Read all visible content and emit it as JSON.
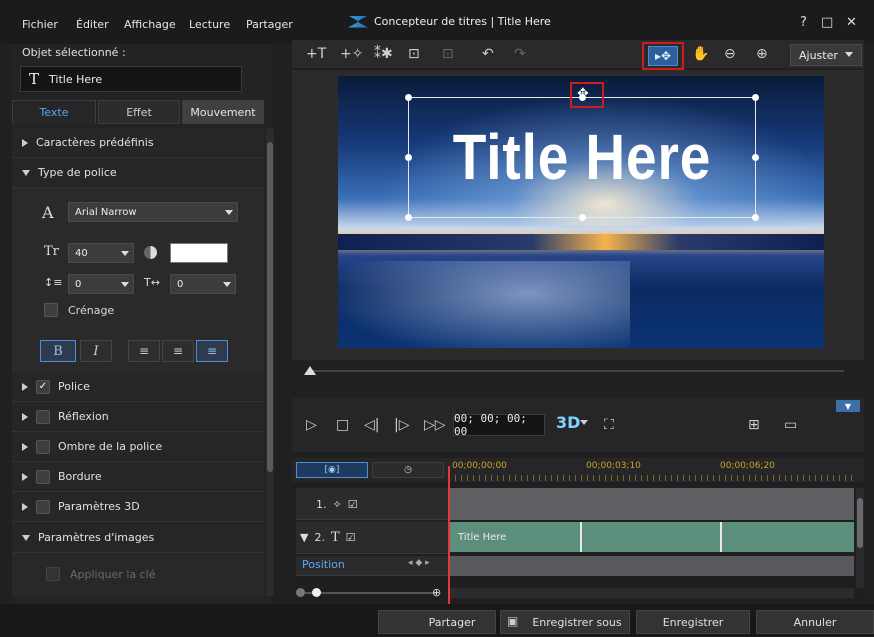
{
  "menu": {
    "items": [
      "Fichier",
      "Éditer",
      "Affichage",
      "Lecture",
      "Partager"
    ]
  },
  "window": {
    "title": "Concepteur de titres  |  Title Here",
    "help": "?",
    "maximize": "□",
    "close": "✕"
  },
  "selected_object": {
    "label": "Objet sélectionné :",
    "value": "Title Here",
    "icon": "T"
  },
  "tabs": [
    "Texte",
    "Effet",
    "Mouvement"
  ],
  "sections": {
    "caracteres": "Caractères prédéfinis",
    "type_police": "Type de police",
    "police": "Police",
    "reflexion": "Réflexion",
    "ombre": "Ombre de la police",
    "bordure": "Bordure",
    "params3d": "Paramètres 3D",
    "params_images": "Paramètres d'images",
    "appliquer": "Appliquer la clé"
  },
  "font": {
    "name": "Arial Narrow",
    "size": "40",
    "line_spacing": "0",
    "char_spacing": "0",
    "kerning_label": "Crénage",
    "color": "#ffffff",
    "bold": "B",
    "italic": "I"
  },
  "toolbar": {
    "fit_label": "Ajuster"
  },
  "preview": {
    "title_text": "Title Here"
  },
  "playback": {
    "timecode": "00; 00; 00; 00",
    "mode_3d": "3D"
  },
  "timeline": {
    "ruler": [
      "00;00;00;00",
      "00;00;03;10",
      "00;00;06;20"
    ],
    "tracks": [
      {
        "label": "1."
      },
      {
        "label": "2."
      }
    ],
    "clip_label": "Title Here",
    "position_label": "Position"
  },
  "bottom": {
    "share": "Partager",
    "save_as": "Enregistrer sous",
    "save": "Enregistrer",
    "cancel": "Annuler"
  },
  "colors": {
    "accent": "#59a8f0",
    "highlight": "#d21c1c",
    "clip": "#5c8e7c",
    "ruler": "#c9a32a"
  }
}
